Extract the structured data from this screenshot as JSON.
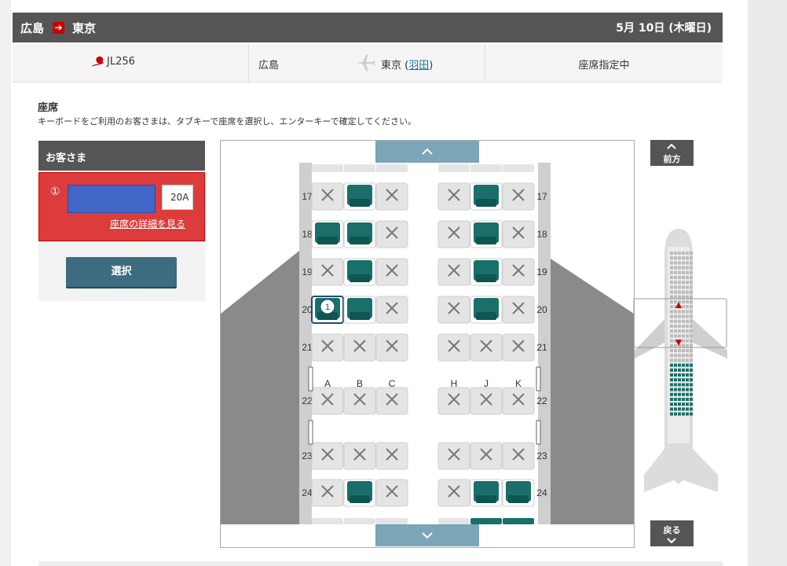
{
  "header": {
    "from": "広島",
    "arrow": "➔",
    "to": "東京",
    "date": "5月 10日 (木曜日)"
  },
  "flight": {
    "number": "JL256",
    "origin": "広島",
    "destination_prefix": "東京 (",
    "destination_airport": "羽田",
    "destination_suffix": ")",
    "status": "座席指定中"
  },
  "section": {
    "title": "座席",
    "instruction": "キーボードをご利用のお客さまは、タブキーで座席を選択し、エンターキーで確定してください。"
  },
  "passenger_panel": {
    "header": "お客さま",
    "passenger_number": "①",
    "seat_value": "20A",
    "seat_detail_link": "座席の詳細を見る",
    "select_button": "選択"
  },
  "controls": {
    "forward_label": "前方",
    "back_label": "戻る"
  },
  "seatmap": {
    "left_columns": [
      "A",
      "B",
      "C"
    ],
    "right_columns": [
      "H",
      "J",
      "K"
    ],
    "rows": [
      {
        "row": "17",
        "seats": [
          "x",
          "a",
          "x",
          "x",
          "a",
          "x"
        ]
      },
      {
        "row": "18",
        "seats": [
          "a",
          "a",
          "x",
          "x",
          "a",
          "x"
        ]
      },
      {
        "row": "19",
        "seats": [
          "x",
          "a",
          "x",
          "x",
          "a",
          "x"
        ]
      },
      {
        "row": "20",
        "seats": [
          "s",
          "a",
          "x",
          "x",
          "a",
          "x"
        ]
      },
      {
        "row": "21",
        "seats": [
          "x",
          "x",
          "x",
          "x",
          "x",
          "x"
        ]
      },
      {
        "row": "22",
        "seats": [
          "x",
          "x",
          "x",
          "x",
          "x",
          "x"
        ]
      },
      {
        "row": "23",
        "seats": [
          "x",
          "x",
          "x",
          "x",
          "x",
          "x"
        ]
      },
      {
        "row": "24",
        "seats": [
          "x",
          "a",
          "x",
          "x",
          "a",
          "a"
        ]
      }
    ],
    "selected_marker": "1",
    "legend_states": {
      "x": "unavailable",
      "a": "available",
      "s": "selected"
    },
    "colors": {
      "available": "#1a6f6a",
      "unavailable": "#e4e4e4",
      "selected": "#1a6f6a",
      "fuselage": "#8a8a8a",
      "accent": "#cc0000"
    }
  }
}
